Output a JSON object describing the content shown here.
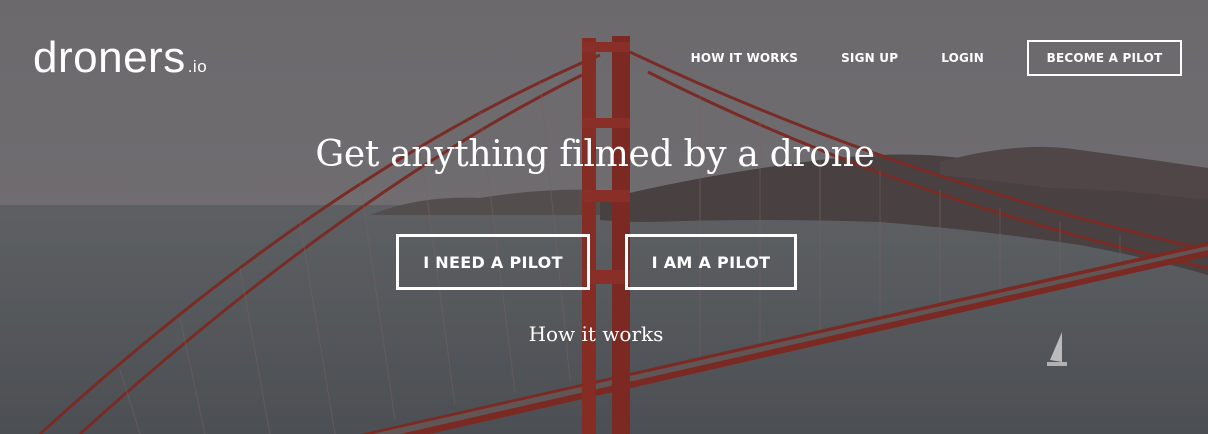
{
  "brand": {
    "name": "droners",
    "suffix": ".io"
  },
  "nav": {
    "links": [
      "HOW IT WORKS",
      "SIGN UP",
      "LOGIN"
    ],
    "cta": "BECOME A PILOT"
  },
  "hero": {
    "headline": "Get anything filmed by a drone",
    "primary_cta": "I NEED A PILOT",
    "secondary_cta": "I AM A PILOT",
    "link": "How it works"
  },
  "colors": {
    "overlay": "#6e6b6e",
    "bridge": "#9a2e24",
    "water": "#5f6367",
    "hills": "#4e4544"
  }
}
